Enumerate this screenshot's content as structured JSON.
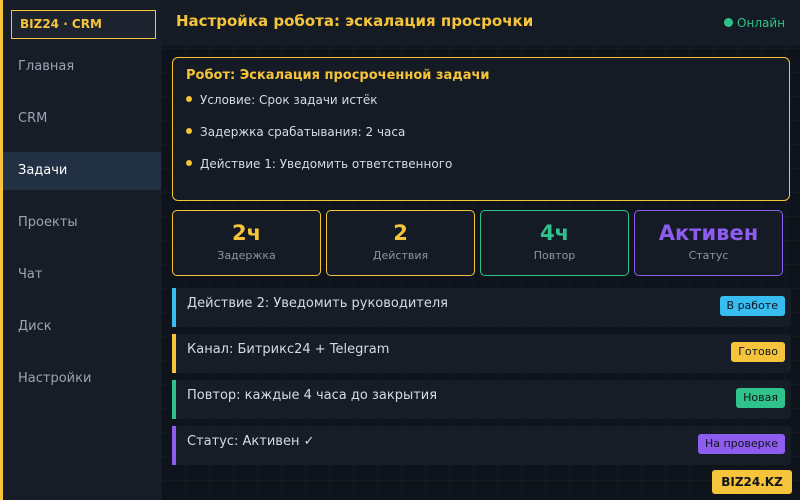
{
  "sidebar": {
    "logo": "BIZ24 · CRM",
    "items": [
      {
        "label": "Главная",
        "active": false
      },
      {
        "label": "CRM",
        "active": false
      },
      {
        "label": "Задачи",
        "active": true
      },
      {
        "label": "Проекты",
        "active": false
      },
      {
        "label": "Чат",
        "active": false
      },
      {
        "label": "Диск",
        "active": false
      },
      {
        "label": "Настройки",
        "active": false
      }
    ]
  },
  "header": {
    "title": "Настройка робота: эскалация просрочки",
    "status": "Онлайн"
  },
  "robot": {
    "title": "Робот: Эскалация просроченной задачи",
    "conditions": [
      "Условие: Срок задачи истёк",
      "Задержка срабатывания: 2 часа",
      "Действие 1: Уведомить ответственного"
    ]
  },
  "stats": [
    {
      "value": "2ч",
      "label": "Задержка",
      "color": "#f5c43a"
    },
    {
      "value": "2",
      "label": "Действия",
      "color": "#f5c43a"
    },
    {
      "value": "4ч",
      "label": "Повтор",
      "color": "#2fc28a"
    },
    {
      "value": "Активен",
      "label": "Статус",
      "color": "#8f5cf0"
    }
  ],
  "rows": [
    {
      "text": "Действие 2: Уведомить руководителя",
      "badge": "В работе",
      "accent": "#38bdf0"
    },
    {
      "text": "Канал: Битрикс24 + Telegram",
      "badge": "Готово",
      "accent": "#f5c43a"
    },
    {
      "text": "Повтор: каждые 4 часа до закрытия",
      "badge": "Новая",
      "accent": "#2fc28a"
    },
    {
      "text": "Статус: Активен ✓",
      "badge": "На проверке",
      "accent": "#8f5cf0"
    }
  ],
  "brand": "BIZ24.KZ",
  "colors": {
    "accent": "#f5c43a",
    "online": "#2fc28a",
    "background": "#0f141c",
    "panel": "#141b25"
  }
}
